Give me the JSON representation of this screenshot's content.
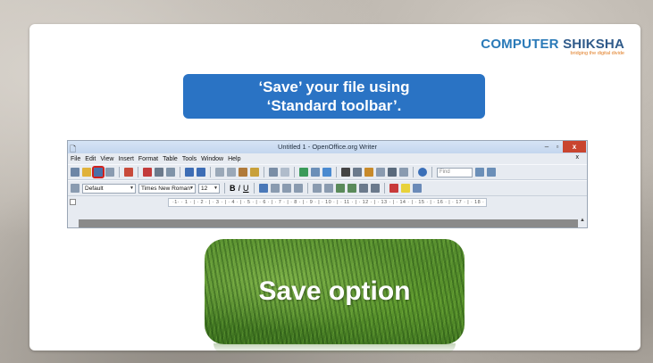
{
  "logo": {
    "part1": "COMPUTER",
    "part2": " SHIKSHA",
    "tagline": "bridging the digital divide"
  },
  "banner": {
    "line1": "‘Save’ your file using",
    "line2": "‘Standard toolbar’."
  },
  "window": {
    "title": "Untitled 1 - OpenOffice.org Writer",
    "menus": [
      "File",
      "Edit",
      "View",
      "Insert",
      "Format",
      "Table",
      "Tools",
      "Window",
      "Help"
    ],
    "close_x": "x",
    "find_placeholder": "Find",
    "style_value": "Default",
    "font_value": "Times New Roman",
    "size_value": "12",
    "bold": "B",
    "italic": "I",
    "underline": "U",
    "ruler_text": "·1·   · 1 · | · 2 · | · 3 · | · 4 · | · 5 · | · 6 · | · 7 · | · 8 · | · 9 · | · 10 · | · 11 · | · 12 · | · 13 · | · 14 · | · 15 · | · 16 · | · 17 · | · 18 ·"
  },
  "image": {
    "caption": "Save option"
  },
  "colors": {
    "banner": "#2a73c4",
    "highlight": "#d0201d",
    "close": "#c9452f"
  }
}
